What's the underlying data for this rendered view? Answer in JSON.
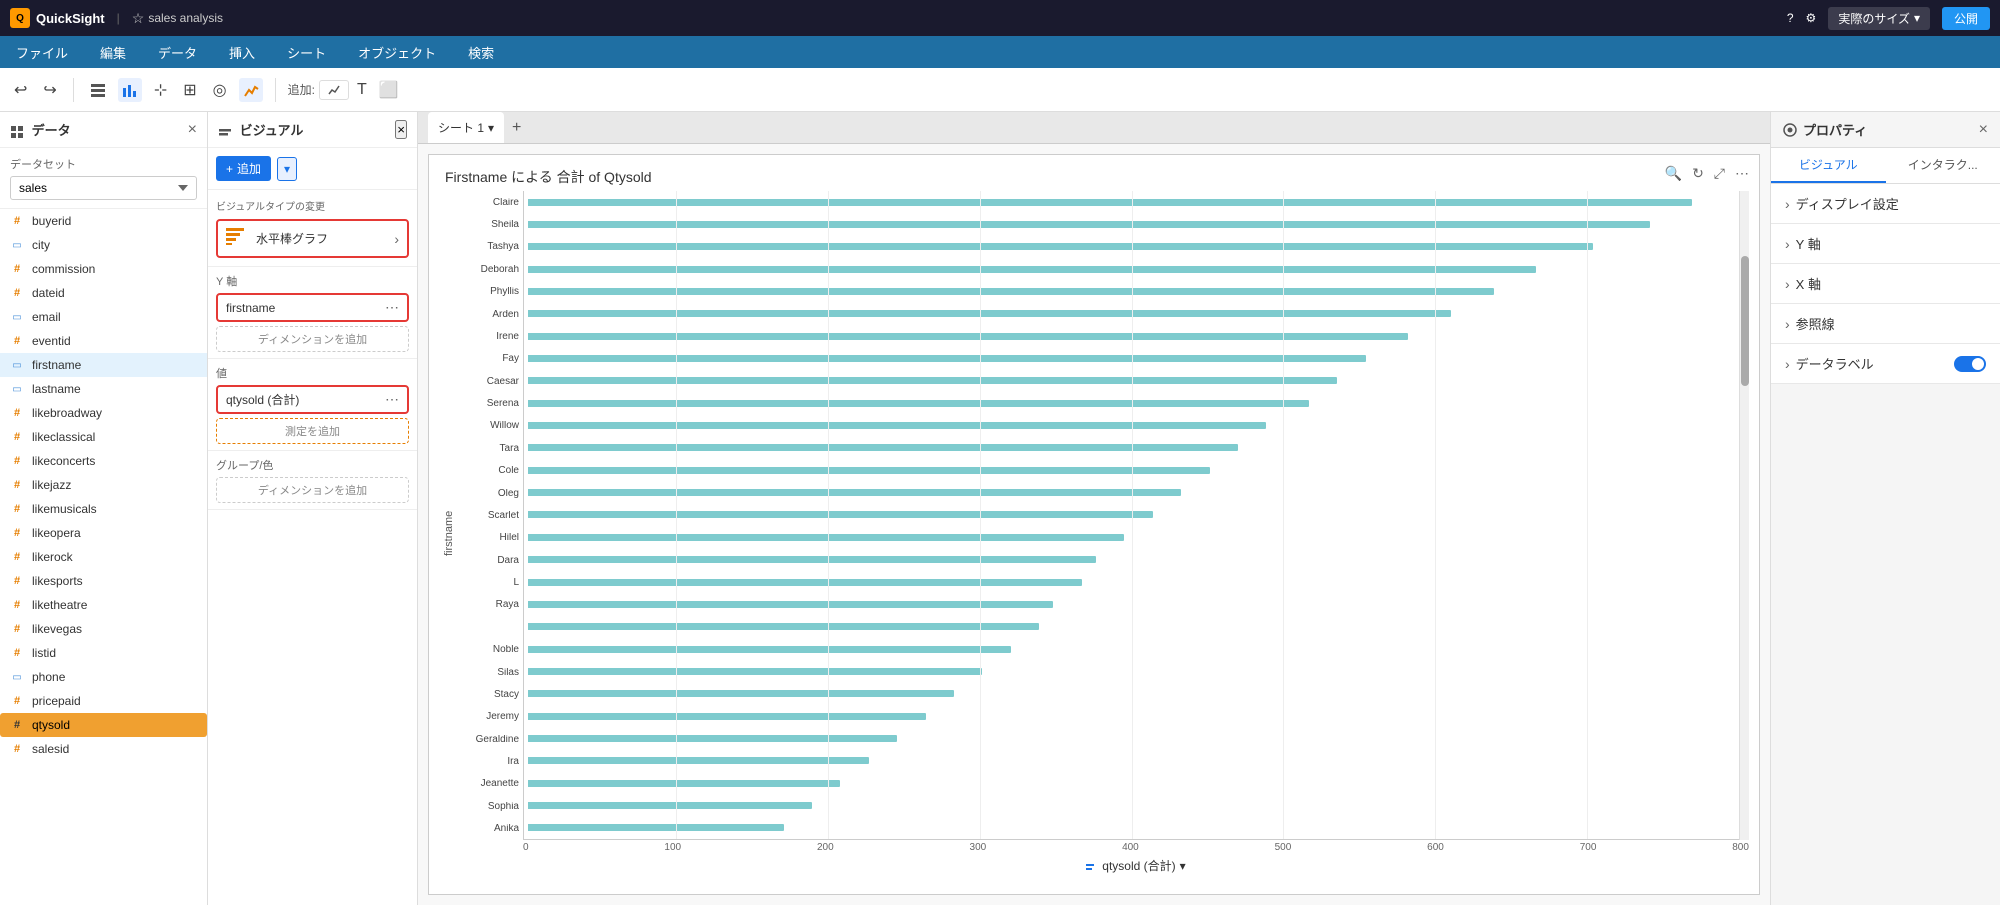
{
  "app": {
    "logo_text": "Q",
    "app_name": "QuickSight",
    "analysis_name": "sales analysis",
    "help_icon": "?",
    "settings_icon": "⚙"
  },
  "topbar": {
    "actual_size_label": "実際のサイズ",
    "publish_label": "公開"
  },
  "menubar": {
    "items": [
      {
        "label": "ファイル"
      },
      {
        "label": "編集"
      },
      {
        "label": "データ"
      },
      {
        "label": "挿入"
      },
      {
        "label": "シート"
      },
      {
        "label": "オブジェクト"
      },
      {
        "label": "検索"
      }
    ]
  },
  "toolbar": {
    "add_label": "追加:"
  },
  "data_panel": {
    "title": "データ",
    "dataset_label": "データセット",
    "dataset_value": "sales",
    "fields": [
      {
        "name": "buyerid",
        "type": "hash"
      },
      {
        "name": "city",
        "type": "dim"
      },
      {
        "name": "commission",
        "type": "hash"
      },
      {
        "name": "dateid",
        "type": "hash"
      },
      {
        "name": "email",
        "type": "dim"
      },
      {
        "name": "eventid",
        "type": "hash"
      },
      {
        "name": "firstname",
        "type": "dim",
        "active_blue": true
      },
      {
        "name": "lastname",
        "type": "dim"
      },
      {
        "name": "likebroadway",
        "type": "hash"
      },
      {
        "name": "likeclassical",
        "type": "hash"
      },
      {
        "name": "likeconcerts",
        "type": "hash"
      },
      {
        "name": "likejazz",
        "type": "hash"
      },
      {
        "name": "likemusicals",
        "type": "hash"
      },
      {
        "name": "likeopera",
        "type": "hash"
      },
      {
        "name": "likerock",
        "type": "hash"
      },
      {
        "name": "likesports",
        "type": "hash"
      },
      {
        "name": "liketheatre",
        "type": "hash"
      },
      {
        "name": "likevegas",
        "type": "hash"
      },
      {
        "name": "listid",
        "type": "hash"
      },
      {
        "name": "phone",
        "type": "dim"
      },
      {
        "name": "pricepaid",
        "type": "hash"
      },
      {
        "name": "qtysold",
        "type": "hash",
        "active": true
      },
      {
        "name": "salesid",
        "type": "hash"
      }
    ]
  },
  "visual_panel": {
    "title": "ビジュアル",
    "change_type_label": "ビジュアルタイプの変更",
    "chart_type_label": "水平棒グラフ",
    "y_axis_label": "Y 軸",
    "y_field": "firstname",
    "add_dimension_label": "ディメンションを追加",
    "value_label": "値",
    "value_field": "qtysold (合計)",
    "add_measure_label": "測定を追加",
    "group_color_label": "グループ/色",
    "add_dimension_color_label": "ディメンションを追加"
  },
  "tabs": {
    "current_tab": "シート 1",
    "add_tab_icon": "+"
  },
  "chart": {
    "title": "Firstname による 合計 of Qtysold",
    "names": [
      "Claire",
      "Sheila",
      "Tashya",
      "Deborah",
      "Phyllis",
      "Arden",
      "Irene",
      "Fay",
      "Caesar",
      "Serena",
      "Willow",
      "Tara",
      "Cole",
      "Oleg",
      "Scarlet",
      "Hilel",
      "Dara",
      "L",
      "Raya",
      "",
      "Noble",
      "Silas",
      "Stacy",
      "Jeremy",
      "Geraldine",
      "Ira",
      "Jeanette",
      "Sophia",
      "Anika"
    ],
    "values": [
      820,
      790,
      750,
      710,
      680,
      650,
      620,
      590,
      570,
      550,
      520,
      500,
      480,
      460,
      440,
      420,
      400,
      390,
      370,
      360,
      340,
      320,
      300,
      280,
      260,
      240,
      220,
      200,
      180
    ],
    "max_value": 850,
    "x_axis_ticks": [
      "0",
      "100",
      "200",
      "300",
      "400",
      "500",
      "600",
      "700",
      "800"
    ],
    "x_axis_title": "qtysold (合計)",
    "y_axis_title": "firstname"
  },
  "properties_panel": {
    "title": "プロパティ",
    "visual_tab": "ビジュアル",
    "interact_tab": "インタラク...",
    "items": [
      {
        "label": "ディスプレイ設定",
        "type": "expand"
      },
      {
        "label": "Y 軸",
        "type": "expand"
      },
      {
        "label": "X 軸",
        "type": "expand"
      },
      {
        "label": "参照線",
        "type": "expand"
      },
      {
        "label": "データラベル",
        "type": "toggle",
        "value": true
      }
    ]
  }
}
